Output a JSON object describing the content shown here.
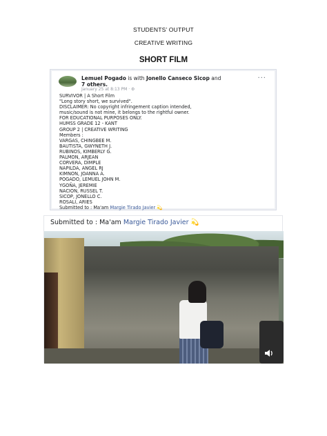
{
  "header": {
    "line1": "STUDENTS’ OUTPUT",
    "line2": "CREATIVE WRITING",
    "title": "SHORT FILM"
  },
  "post": {
    "author": "Lemuel Pogado",
    "with_text": " is with ",
    "tagged": "Jonello Canseco Sicop",
    "and_text": " and ",
    "others": "7 others",
    "others_suffix": ".",
    "time": "January 25 at 8:13 PM · ⚙",
    "more": "···",
    "lines": [
      "SURVIVOR | A Short Film",
      "\"Long story short, we survived\".",
      "DISCLAIMER: No copyright infringement caption intended,",
      "music/sound is not mine, it belongs to the rightful owner.",
      "FOR EDUCATIONAL PURPOSES ONLY.",
      "HUMSS GRADE 12 - KANT",
      "GROUP 2 | CREATIVE WRITING",
      "Members :",
      "VARGAS, CHINGBEE M.",
      "BAUTISTA, GWYNETH J.",
      "RUBINOS, KIMBERLY G.",
      "PALMON, ARJEAN",
      "CORVERA, DIMPLE",
      "NAPILDA, ANGEL RJ",
      "KIMNON, JOANNA A.",
      "POGADO, LEMUEL JOHN M.",
      "YGOÑA, JEREMIE",
      "NACION, RUSSEL T.",
      "SICOP, JONELLO C.",
      "ROSALI, ARIES"
    ],
    "submitted_prefix": "Submitted to : Ma'am ",
    "submitted_name": "Margie Tirado Javier",
    "emoji": "💫"
  },
  "video": {
    "submitted_prefix": "Submitted to : Ma'am ",
    "submitted_name": "Margie Tirado Javier",
    "emoji": "💫",
    "volume_icon": "speaker-icon"
  }
}
